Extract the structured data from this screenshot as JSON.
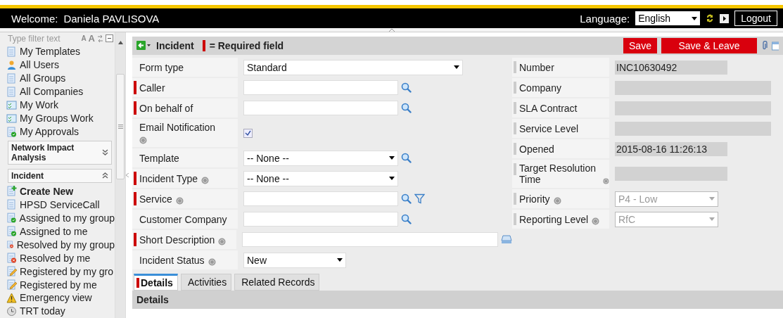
{
  "header": {
    "welcome_label": "Welcome:",
    "user": "Daniela PAVLISOVA",
    "language_label": "Language:",
    "language": "English",
    "logout": "Logout"
  },
  "sidebar": {
    "filter": {
      "placeholder": "Type filter text",
      "font_buttons": [
        "A",
        "A"
      ]
    },
    "items": [
      {
        "label": "My Templates",
        "kind": "page"
      },
      {
        "label": "All Users",
        "kind": "users"
      },
      {
        "label": "All Groups",
        "kind": "page"
      },
      {
        "label": "All Companies",
        "kind": "page"
      },
      {
        "label": "My Work",
        "kind": "work"
      },
      {
        "label": "My Groups Work",
        "kind": "work"
      },
      {
        "label": "My Approvals",
        "kind": "approval"
      }
    ],
    "sections": [
      {
        "title": "Network Impact Analysis",
        "expanded": false
      },
      {
        "title": "Incident",
        "expanded": true,
        "items": [
          {
            "label": "Create New",
            "kind": "create"
          },
          {
            "label": "HPSD ServiceCall",
            "kind": "page"
          },
          {
            "label": "Assigned to my group",
            "kind": "assigned"
          },
          {
            "label": "Assigned to me",
            "kind": "assigned"
          },
          {
            "label": "Resolved by my group",
            "kind": "resolved"
          },
          {
            "label": "Resolved by me",
            "kind": "resolved"
          },
          {
            "label": "Registered by my gro",
            "kind": "registered"
          },
          {
            "label": "Registered by me",
            "kind": "registered"
          },
          {
            "label": "Emergency view",
            "kind": "warning"
          },
          {
            "label": "TRT today",
            "kind": "clock"
          }
        ]
      }
    ]
  },
  "form": {
    "title": "Incident",
    "required_legend": "= Required field",
    "buttons": [
      "Save",
      "Save & Leave"
    ],
    "left_fields": [
      {
        "label": "Form type",
        "required": false,
        "help": false,
        "kind": "wide_select",
        "value": "Standard"
      },
      {
        "label": "Caller",
        "required": true,
        "help": false,
        "kind": "lookup"
      },
      {
        "label": "On behalf of",
        "required": true,
        "help": false,
        "kind": "lookup"
      },
      {
        "label": "Email Notification",
        "required": false,
        "help": true,
        "kind": "checkbox",
        "checked": true
      },
      {
        "label": "Template",
        "required": false,
        "help": false,
        "kind": "select_lookup",
        "value": "-- None --"
      },
      {
        "label": "Incident Type",
        "required": true,
        "help": true,
        "kind": "select",
        "value": "-- None --"
      },
      {
        "label": "Service",
        "required": true,
        "help": true,
        "kind": "lookup_filter"
      },
      {
        "label": "Customer Company",
        "required": false,
        "help": false,
        "kind": "lookup"
      },
      {
        "label": "Short Description",
        "required": true,
        "help": true,
        "kind": "long_text"
      },
      {
        "label": "Incident Status",
        "required": false,
        "help": true,
        "kind": "short_select",
        "value": "New"
      }
    ],
    "right_fields": [
      {
        "label": "Number",
        "help": false,
        "kind": "readonly_short",
        "value": "INC10630492"
      },
      {
        "label": "Company",
        "help": false,
        "kind": "readonly"
      },
      {
        "label": "SLA Contract",
        "help": false,
        "kind": "readonly"
      },
      {
        "label": "Service Level",
        "help": false,
        "kind": "readonly"
      },
      {
        "label": "Opened",
        "help": false,
        "kind": "readonly_short",
        "value": "2015-08-16 11:26:13"
      },
      {
        "label": "Target Resolution Time",
        "help": true,
        "kind": "readonly_short"
      },
      {
        "label": "Priority",
        "help": true,
        "kind": "disabled_select",
        "value": "P4 - Low"
      },
      {
        "label": "Reporting Level",
        "help": true,
        "kind": "disabled_select",
        "value": "RfC"
      }
    ],
    "tabs": [
      {
        "label": "Details",
        "selected": true,
        "required": true
      },
      {
        "label": "Activities",
        "selected": false,
        "required": false
      },
      {
        "label": "Related Records",
        "selected": false,
        "required": false
      }
    ],
    "section_title": "Details"
  }
}
